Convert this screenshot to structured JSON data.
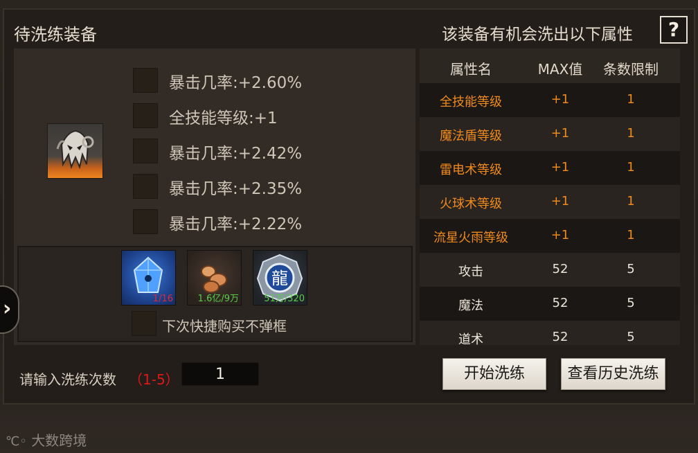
{
  "header": {
    "left_title": "待洗练装备",
    "right_title": "该装备有机会洗出以下属性",
    "help_label": "?"
  },
  "attributes": [
    "暴击几率:+2.60%",
    "全技能等级:+1",
    "暴击几率:+2.42%",
    "暴击几率:+2.35%",
    "暴击几率:+2.22%"
  ],
  "materials": [
    {
      "icon": "blue-crystal-icon",
      "count": "1/16",
      "count_color": "#e0283a"
    },
    {
      "icon": "gold-coins-icon",
      "count": "1.6亿/9万",
      "count_color": "#58d04a"
    },
    {
      "icon": "dragon-medal-icon",
      "count": "51万/320",
      "count_color": "#58d04a"
    }
  ],
  "quick_buy_label": "下次快捷购买不弹框",
  "table": {
    "headers": [
      "属性名",
      "MAX值",
      "条数限制"
    ],
    "rows": [
      {
        "name": "全技能等级",
        "max": "+1",
        "limit": "1",
        "color": "#f08a1c"
      },
      {
        "name": "魔法盾等级",
        "max": "+1",
        "limit": "1",
        "color": "#f08a1c"
      },
      {
        "name": "雷电术等级",
        "max": "+1",
        "limit": "1",
        "color": "#f08a1c"
      },
      {
        "name": "火球术等级",
        "max": "+1",
        "limit": "1",
        "color": "#f08a1c"
      },
      {
        "name": "流星火雨等级",
        "max": "+1",
        "limit": "1",
        "color": "#f08a1c"
      },
      {
        "name": "攻击",
        "max": "52",
        "limit": "5",
        "color": "#ece5d9"
      },
      {
        "name": "魔法",
        "max": "52",
        "limit": "5",
        "color": "#ece5d9"
      },
      {
        "name": "道术",
        "max": "52",
        "limit": "5",
        "color": "#ece5d9"
      }
    ]
  },
  "input": {
    "label": "请输入洗练次数",
    "range": "（1-5）",
    "value": "1"
  },
  "buttons": {
    "start": "开始洗练",
    "history": "查看历史洗练"
  },
  "watermark": "大数跨境",
  "colors": {
    "highlight": "#f08a1c",
    "range_red": "#e01818"
  }
}
